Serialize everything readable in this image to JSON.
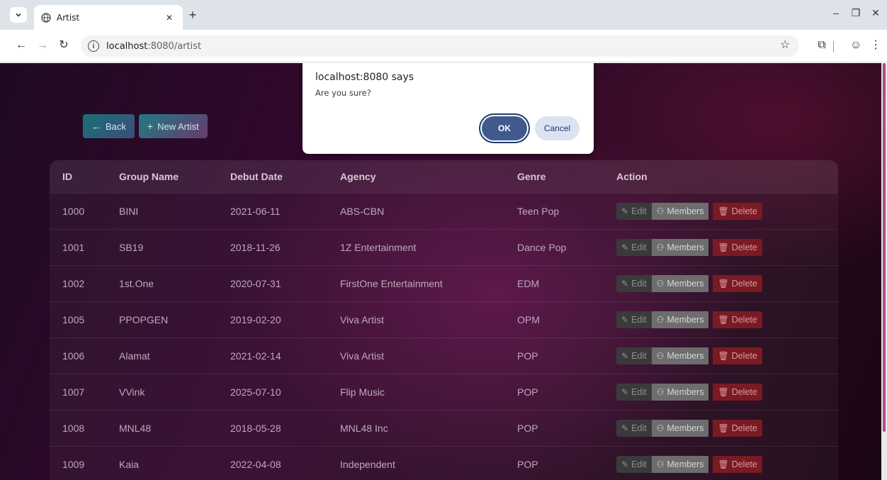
{
  "browser": {
    "tab_title": "Artist",
    "url_host": "localhost",
    "url_path": ":8080/artist"
  },
  "page": {
    "back_label": "Back",
    "new_label": "New Artist"
  },
  "table": {
    "headers": {
      "id": "ID",
      "name": "Group Name",
      "debut": "Debut Date",
      "agency": "Agency",
      "genre": "Genre",
      "action": "Action"
    },
    "rows": [
      {
        "id": "1000",
        "name": "BINI",
        "debut": "2021-06-11",
        "agency": "ABS-CBN",
        "genre": "Teen Pop"
      },
      {
        "id": "1001",
        "name": "SB19",
        "debut": "2018-11-26",
        "agency": "1Z Entertainment",
        "genre": "Dance Pop"
      },
      {
        "id": "1002",
        "name": "1st.One",
        "debut": "2020-07-31",
        "agency": "FirstOne Entertainment",
        "genre": "EDM"
      },
      {
        "id": "1005",
        "name": "PPOPGEN",
        "debut": "2019-02-20",
        "agency": "Viva Artist",
        "genre": "OPM"
      },
      {
        "id": "1006",
        "name": "Alamat",
        "debut": "2021-02-14",
        "agency": "Viva Artist",
        "genre": "POP"
      },
      {
        "id": "1007",
        "name": "VVink",
        "debut": "2025-07-10",
        "agency": "Flip Music",
        "genre": "POP"
      },
      {
        "id": "1008",
        "name": "MNL48",
        "debut": "2018-05-28",
        "agency": "MNL48 Inc",
        "genre": "POP"
      },
      {
        "id": "1009",
        "name": "Kaia",
        "debut": "2022-04-08",
        "agency": "Independent",
        "genre": "POP"
      }
    ],
    "action_labels": {
      "edit": "Edit",
      "members": "Members",
      "delete": "Delete"
    }
  },
  "dialog": {
    "title": "localhost:8080 says",
    "message": "Are you sure?",
    "ok_label": "OK",
    "cancel_label": "Cancel"
  }
}
